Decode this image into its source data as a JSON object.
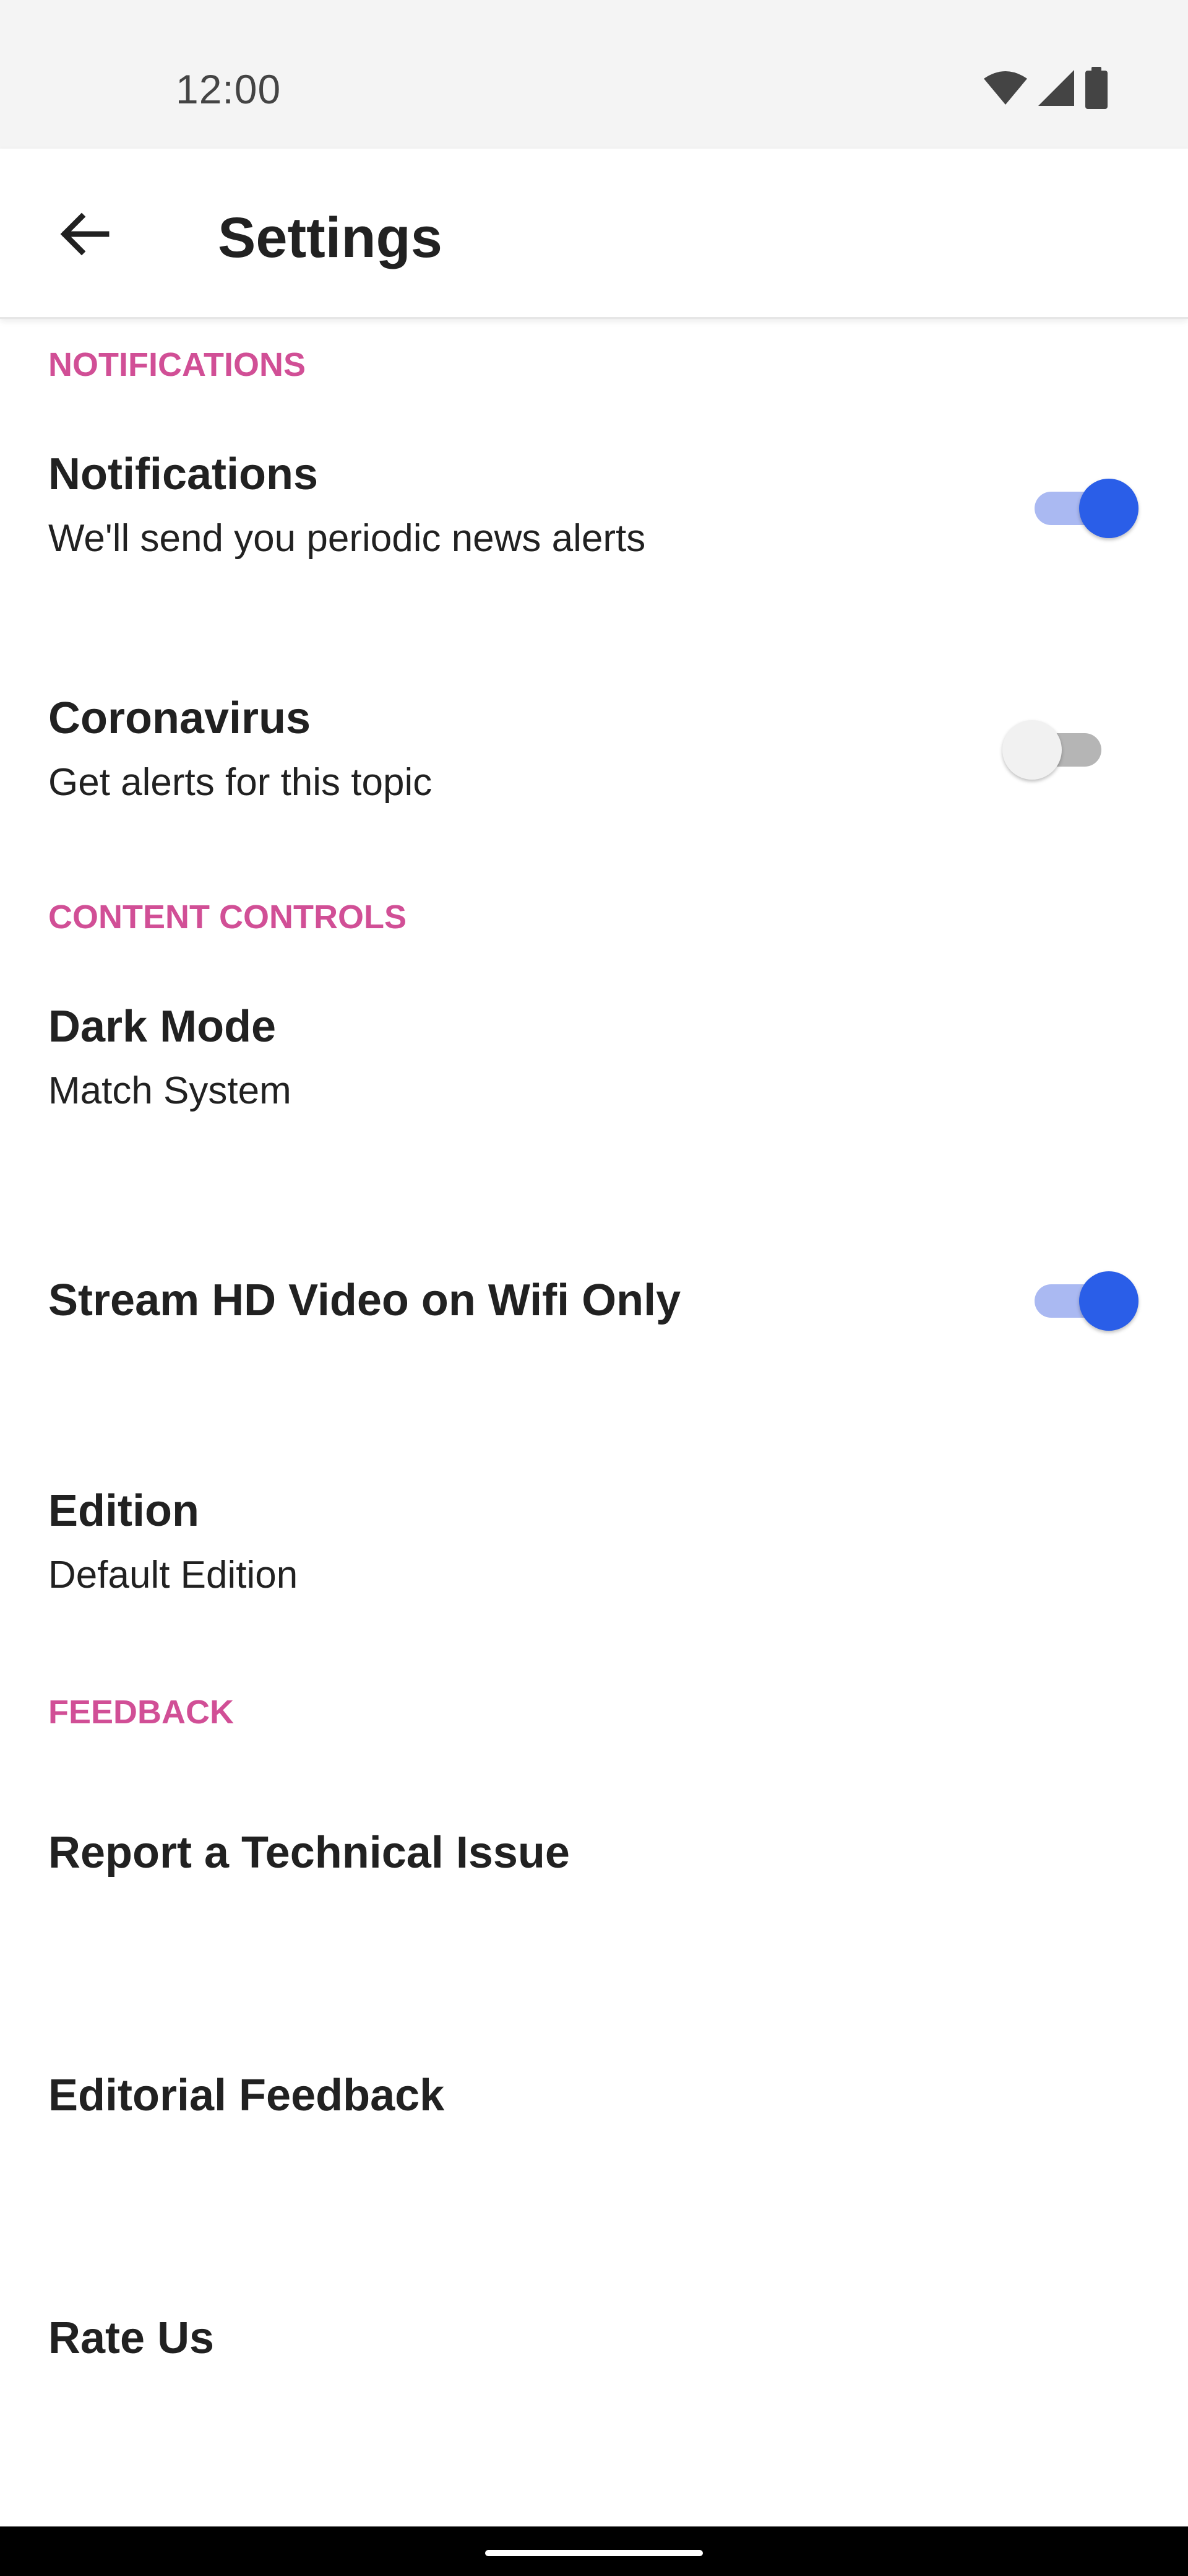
{
  "status_bar": {
    "time": "12:00",
    "icons": [
      "wifi-icon",
      "signal-icon",
      "battery-icon"
    ]
  },
  "header": {
    "back_icon": "arrow-left-icon",
    "title": "Settings"
  },
  "sections": {
    "notifications": {
      "header": "NOTIFICATIONS",
      "notifications": {
        "title": "Notifications",
        "subtitle": "We'll send you periodic news alerts",
        "enabled": true
      },
      "coronavirus": {
        "title": "Coronavirus",
        "subtitle": "Get alerts for this topic",
        "enabled": false
      }
    },
    "content_controls": {
      "header": "CONTENT CONTROLS",
      "dark_mode": {
        "title": "Dark Mode",
        "subtitle": "Match System"
      },
      "stream_hd": {
        "title": "Stream HD Video on Wifi Only",
        "enabled": true
      },
      "edition": {
        "title": "Edition",
        "subtitle": "Default Edition"
      }
    },
    "feedback": {
      "header": "FEEDBACK",
      "report_issue": {
        "title": "Report a Technical Issue"
      },
      "editorial_feedback": {
        "title": "Editorial Feedback"
      },
      "rate_us": {
        "title": "Rate Us"
      }
    }
  },
  "colors": {
    "section_header": "#d14f96",
    "toggle_on_thumb": "#2a5ee8",
    "toggle_on_track": "#aab9f2",
    "toggle_off_thumb": "#f1f1f1",
    "toggle_off_track": "#b5b5b5",
    "status_bar_bg": "#f4f4f4",
    "text": "#212121"
  }
}
